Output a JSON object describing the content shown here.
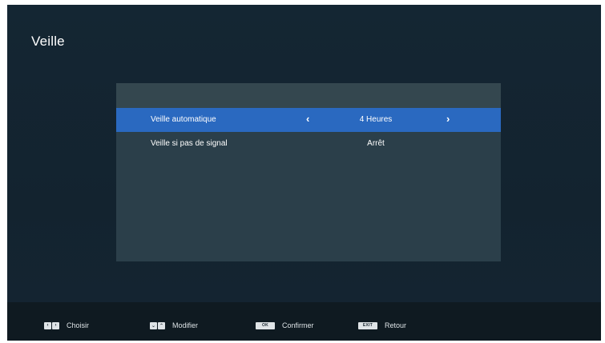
{
  "page": {
    "title": "Veille"
  },
  "menu": {
    "items": [
      {
        "label": "Veille automatique",
        "value": "4 Heures",
        "left_arrow": "‹",
        "right_arrow": "›"
      },
      {
        "label": "Veille si pas de signal",
        "value": "Arrêt"
      }
    ]
  },
  "footer": {
    "choisir": {
      "label": "Choisir",
      "keys": [
        "‹",
        "›"
      ]
    },
    "modifier": {
      "label": "Modifier",
      "keys": [
        "⌄",
        "⌃"
      ]
    },
    "confirmer": {
      "label": "Confirmer",
      "key": "OK"
    },
    "retour": {
      "label": "Retour",
      "key": "EXIT"
    }
  },
  "colors": {
    "background": "#142633",
    "panel": "#2b3f4a",
    "selected_row": "#2a69c0",
    "footer": "#0f1a21"
  },
  "icons": {
    "left_arrow": "chevron-left-icon",
    "right_arrow": "chevron-right-icon",
    "down_key": "arrow-down-key-icon",
    "up_key": "arrow-up-key-icon"
  }
}
